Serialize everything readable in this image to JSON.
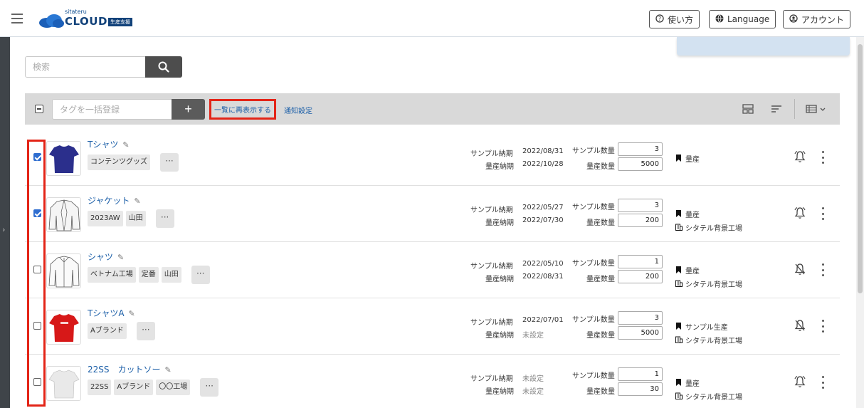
{
  "header": {
    "logo_small": "sitateru",
    "logo_main": "CLOUD",
    "logo_badge": "生産支援",
    "help_label": "使い方",
    "language_label": "Language",
    "account_label": "アカウント"
  },
  "search": {
    "placeholder": "検索"
  },
  "toolbar": {
    "tag_placeholder": "タグを一括登録",
    "add_label": "+",
    "redisplay_label": "一覧に再表示する",
    "notify_label": "通知設定"
  },
  "labels": {
    "sample_delivery": "サンプル納期",
    "mass_delivery": "量産納期",
    "sample_qty": "サンプル数量",
    "mass_qty": "量産数量"
  },
  "items": [
    {
      "name": "Tシャツ",
      "tags": [
        "コンテンツグッズ"
      ],
      "sample_date": "2022/08/31",
      "mass_date": "2022/10/28",
      "sample_qty": "3",
      "mass_qty": "5000",
      "status": "量産",
      "factory": "",
      "checked": true,
      "bell": "on",
      "thumb": "tshirt-navy"
    },
    {
      "name": "ジャケット",
      "tags": [
        "2023AW",
        "山田"
      ],
      "sample_date": "2022/05/27",
      "mass_date": "2022/07/30",
      "sample_qty": "3",
      "mass_qty": "200",
      "status": "量産",
      "factory": "シタテル背景工場",
      "checked": true,
      "bell": "on",
      "thumb": "jacket"
    },
    {
      "name": "シャツ",
      "tags": [
        "ベトナム工場",
        "定番",
        "山田"
      ],
      "sample_date": "2022/05/10",
      "mass_date": "2022/08/31",
      "sample_qty": "1",
      "mass_qty": "200",
      "status": "量産",
      "factory": "シタテル背景工場",
      "checked": false,
      "bell": "off",
      "thumb": "shirt"
    },
    {
      "name": "TシャツA",
      "tags": [
        "Aブランド"
      ],
      "sample_date": "2022/07/01",
      "mass_date": "未設定",
      "sample_qty": "3",
      "mass_qty": "5000",
      "status": "サンプル生産",
      "factory": "シタテル背景工場",
      "checked": false,
      "bell": "off",
      "thumb": "tshirt-red"
    },
    {
      "name": "22SS　カットソー",
      "tags": [
        "22SS",
        "Aブランド",
        "〇〇工場"
      ],
      "sample_date": "未設定",
      "mass_date": "未設定",
      "sample_qty": "1",
      "mass_qty": "30",
      "status": "量産",
      "factory": "シタテル背景工場",
      "checked": false,
      "bell": "on",
      "thumb": "tshirt-white"
    }
  ],
  "colors": {
    "accent": "#1c5fa8",
    "highlight": "#e32417",
    "navy": "#12427a"
  }
}
